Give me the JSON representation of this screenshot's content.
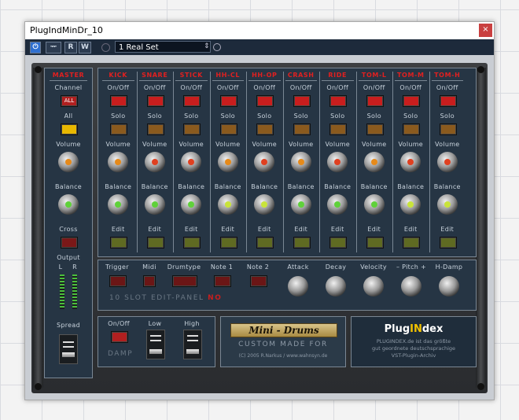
{
  "window": {
    "title": "PlugIndMinDr_10",
    "close": "×"
  },
  "toolbar": {
    "power": "⏻",
    "compare": "ᅲ",
    "r_label": "R",
    "w_label": "W",
    "preset": "1 Real Set",
    "updown": "⇕"
  },
  "master": {
    "header": "MASTER",
    "channel_label": "Channel",
    "channel_value": "ALL",
    "all_label": "All",
    "volume_label": "Volume",
    "balance_label": "Balance",
    "cross_label": "Cross",
    "output_label": "Output",
    "out_l": "L",
    "out_r": "R",
    "spread_label": "Spread"
  },
  "channels": [
    {
      "name": "KICK",
      "vol_color": "#e68a1a",
      "bal_color": "#5fd13a"
    },
    {
      "name": "SNARE",
      "vol_color": "#e04020",
      "bal_color": "#5fd13a"
    },
    {
      "name": "STICK",
      "vol_color": "#e04020",
      "bal_color": "#5fd13a"
    },
    {
      "name": "HH-CL",
      "vol_color": "#e68a1a",
      "bal_color": "#c9e43a"
    },
    {
      "name": "HH-OP",
      "vol_color": "#e04020",
      "bal_color": "#c9e43a"
    },
    {
      "name": "CRASH",
      "vol_color": "#e68a1a",
      "bal_color": "#5fd13a"
    },
    {
      "name": "RIDE",
      "vol_color": "#e04020",
      "bal_color": "#5fd13a"
    },
    {
      "name": "TOM-L",
      "vol_color": "#e68a1a",
      "bal_color": "#5fd13a"
    },
    {
      "name": "TOM-M",
      "vol_color": "#e04020",
      "bal_color": "#c9e43a"
    },
    {
      "name": "TOM-H",
      "vol_color": "#e04020",
      "bal_color": "#c9e43a"
    }
  ],
  "channel_labels": {
    "onoff": "On/Off",
    "solo": "Solo",
    "volume": "Volume",
    "balance": "Balance",
    "edit": "Edit"
  },
  "edit_panel": {
    "trigger": "Trigger",
    "midi": "Midi",
    "drumtype": "Drumtype",
    "note1": "Note 1",
    "note2": "Note 2",
    "attack": "Attack",
    "decay": "Decay",
    "velocity": "Velocity",
    "pitch": "– Pitch +",
    "hdamp": "H-Damp",
    "caption": "10 SLOT EDIT-PANEL",
    "slot": "NO"
  },
  "damp": {
    "onoff": "On/Off",
    "low": "Low",
    "high": "High",
    "label": "DAMP"
  },
  "logo": {
    "title": "Mini - Drums",
    "custom": "CUSTOM MADE FOR",
    "copyright": "(C) 2005 R.Narkus / www.wahnsyn.de"
  },
  "pluginindex": {
    "name_a": "Plug",
    "name_b": "IN",
    "name_c": "dex",
    "line1": "PLUGINDEX.de ist das größte",
    "line2": "gut geordnete deutschsprachige",
    "line3": "VST-Plugin-Archiv"
  }
}
